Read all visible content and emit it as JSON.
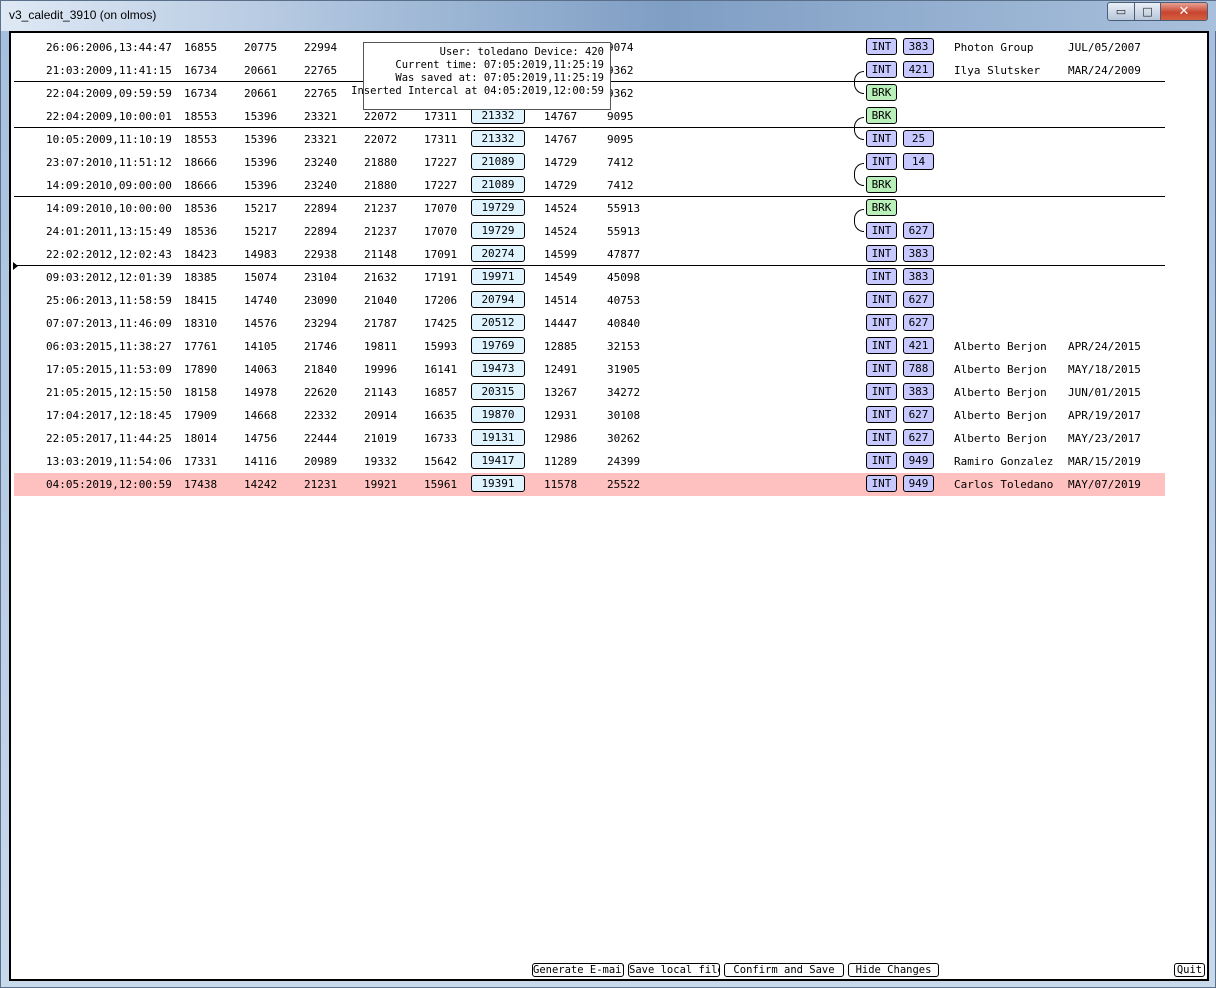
{
  "window": {
    "title": "v3_caledit_3910 (on olmos)",
    "close_glyph": "✕",
    "max_glyph": "□",
    "min_glyph": "▭"
  },
  "tooltip": {
    "line1": "User: toledano Device: 420",
    "line2": "Current time: 07:05:2019,11:25:19",
    "line3": "Was saved at: 07:05:2019,11:25:19",
    "line4": "Inserted Intercal at 04:05:2019,12:00:59"
  },
  "rows": [
    {
      "date": "26:06:2006,13:44:47",
      "n1": "16855",
      "n2": "20775",
      "n3": "22994",
      "n4": "",
      "n5": "",
      "box": "",
      "n7": "",
      "n8": "9074",
      "type": "INT",
      "num": "383",
      "name": "Photon Group",
      "edate": "JUL/05/2007"
    },
    {
      "date": "21:03:2009,11:41:15",
      "n1": "16734",
      "n2": "20661",
      "n3": "22765",
      "n4": "",
      "n5": "",
      "box": "",
      "n7": "",
      "n8": "9362",
      "type": "INT",
      "num": "421",
      "name": "Ilya Slutsker",
      "edate": "MAR/24/2009"
    },
    {
      "date": "22:04:2009,09:59:59",
      "n1": "16734",
      "n2": "20661",
      "n3": "22765",
      "n4": "",
      "n5": "",
      "box": "",
      "n7": "",
      "n8": "9362",
      "type": "BRK",
      "num": "",
      "name": "",
      "edate": ""
    },
    {
      "date": "22:04:2009,10:00:01",
      "n1": "18553",
      "n2": "15396",
      "n3": "23321",
      "n4": "22072",
      "n5": "17311",
      "box": "21332",
      "n7": "14767",
      "n8": "9095",
      "type": "BRK",
      "num": "",
      "name": "",
      "edate": ""
    },
    {
      "date": "10:05:2009,11:10:19",
      "n1": "18553",
      "n2": "15396",
      "n3": "23321",
      "n4": "22072",
      "n5": "17311",
      "box": "21332",
      "n7": "14767",
      "n8": "9095",
      "type": "INT",
      "num": "25",
      "name": "",
      "edate": ""
    },
    {
      "date": "23:07:2010,11:51:12",
      "n1": "18666",
      "n2": "15396",
      "n3": "23240",
      "n4": "21880",
      "n5": "17227",
      "box": "21089",
      "n7": "14729",
      "n8": "7412",
      "type": "INT",
      "num": "14",
      "name": "",
      "edate": ""
    },
    {
      "date": "14:09:2010,09:00:00",
      "n1": "18666",
      "n2": "15396",
      "n3": "23240",
      "n4": "21880",
      "n5": "17227",
      "box": "21089",
      "n7": "14729",
      "n8": "7412",
      "type": "BRK",
      "num": "",
      "name": "",
      "edate": ""
    },
    {
      "date": "14:09:2010,10:00:00",
      "n1": "18536",
      "n2": "15217",
      "n3": "22894",
      "n4": "21237",
      "n5": "17070",
      "box": "19729",
      "n7": "14524",
      "n8": "55913",
      "type": "BRK",
      "num": "",
      "name": "",
      "edate": ""
    },
    {
      "date": "24:01:2011,13:15:49",
      "n1": "18536",
      "n2": "15217",
      "n3": "22894",
      "n4": "21237",
      "n5": "17070",
      "box": "19729",
      "n7": "14524",
      "n8": "55913",
      "type": "INT",
      "num": "627",
      "name": "",
      "edate": ""
    },
    {
      "date": "22:02:2012,12:02:43",
      "n1": "18423",
      "n2": "14983",
      "n3": "22938",
      "n4": "21148",
      "n5": "17091",
      "box": "20274",
      "n7": "14599",
      "n8": "47877",
      "type": "INT",
      "num": "383",
      "name": "",
      "edate": ""
    },
    {
      "date": "09:03:2012,12:01:39",
      "n1": "18385",
      "n2": "15074",
      "n3": "23104",
      "n4": "21632",
      "n5": "17191",
      "box": "19971",
      "n7": "14549",
      "n8": "45098",
      "type": "INT",
      "num": "383",
      "name": "",
      "edate": ""
    },
    {
      "date": "25:06:2013,11:58:59",
      "n1": "18415",
      "n2": "14740",
      "n3": "23090",
      "n4": "21040",
      "n5": "17206",
      "box": "20794",
      "n7": "14514",
      "n8": "40753",
      "type": "INT",
      "num": "627",
      "name": "",
      "edate": ""
    },
    {
      "date": "07:07:2013,11:46:09",
      "n1": "18310",
      "n2": "14576",
      "n3": "23294",
      "n4": "21787",
      "n5": "17425",
      "box": "20512",
      "n7": "14447",
      "n8": "40840",
      "type": "INT",
      "num": "627",
      "name": "",
      "edate": ""
    },
    {
      "date": "06:03:2015,11:38:27",
      "n1": "17761",
      "n2": "14105",
      "n3": "21746",
      "n4": "19811",
      "n5": "15993",
      "box": "19769",
      "n7": "12885",
      "n8": "32153",
      "type": "INT",
      "num": "421",
      "name": "Alberto Berjon",
      "edate": "APR/24/2015"
    },
    {
      "date": "17:05:2015,11:53:09",
      "n1": "17890",
      "n2": "14063",
      "n3": "21840",
      "n4": "19996",
      "n5": "16141",
      "box": "19473",
      "n7": "12491",
      "n8": "31905",
      "type": "INT",
      "num": "788",
      "name": "Alberto Berjon",
      "edate": "MAY/18/2015"
    },
    {
      "date": "21:05:2015,12:15:50",
      "n1": "18158",
      "n2": "14978",
      "n3": "22620",
      "n4": "21143",
      "n5": "16857",
      "box": "20315",
      "n7": "13267",
      "n8": "34272",
      "type": "INT",
      "num": "383",
      "name": "Alberto Berjon",
      "edate": "JUN/01/2015"
    },
    {
      "date": "17:04:2017,12:18:45",
      "n1": "17909",
      "n2": "14668",
      "n3": "22332",
      "n4": "20914",
      "n5": "16635",
      "box": "19870",
      "n7": "12931",
      "n8": "30108",
      "type": "INT",
      "num": "627",
      "name": "Alberto Berjon",
      "edate": "APR/19/2017"
    },
    {
      "date": "22:05:2017,11:44:25",
      "n1": "18014",
      "n2": "14756",
      "n3": "22444",
      "n4": "21019",
      "n5": "16733",
      "box": "19131",
      "n7": "12986",
      "n8": "30262",
      "type": "INT",
      "num": "627",
      "name": "Alberto Berjon",
      "edate": "MAY/23/2017"
    },
    {
      "date": "13:03:2019,11:54:06",
      "n1": "17331",
      "n2": "14116",
      "n3": "20989",
      "n4": "19332",
      "n5": "15642",
      "box": "19417",
      "n7": "11289",
      "n8": "24399",
      "type": "INT",
      "num": "949",
      "name": "Ramiro Gonzalez",
      "edate": "MAR/15/2019"
    },
    {
      "date": "04:05:2019,12:00:59",
      "n1": "17438",
      "n2": "14242",
      "n3": "21231",
      "n4": "19921",
      "n5": "15961",
      "box": "19391",
      "n7": "11578",
      "n8": "25522",
      "type": "INT",
      "num": "949",
      "name": "Carlos Toledano",
      "edate": "MAY/07/2019"
    }
  ],
  "selected_row": 19,
  "buttons": {
    "generate_email": "Generate E-mail",
    "save_local": "Save local file",
    "confirm_save": "Confirm and Save",
    "hide_changes": "Hide Changes",
    "quit": "Quit"
  },
  "colors": {
    "selected_row": "#ffc0c0",
    "int_tag": "#c6c8ff",
    "brk_tag": "#b9f0b9",
    "value_box": "#dff4ff"
  }
}
